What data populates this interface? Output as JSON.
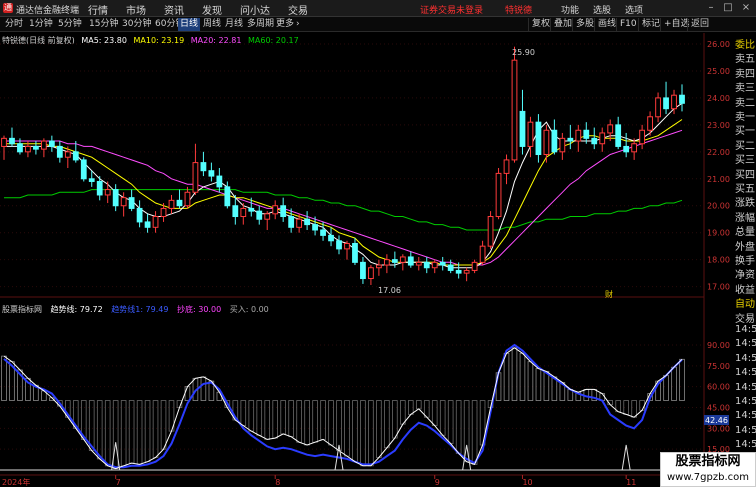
{
  "titlebar": {
    "app_title": "通达信金融终端",
    "menu": [
      "行情",
      "市场",
      "资讯",
      "发现",
      "问小达",
      "交易"
    ],
    "notice": "证券交易未登录",
    "stock_name": "特锐德",
    "right_menu": [
      "功能",
      "选股",
      "选项"
    ],
    "min_btn": "–",
    "max_btn": "□",
    "close_btn": "×"
  },
  "periodbar": {
    "tabs": [
      "分时",
      "1分钟",
      "5分钟",
      "15分钟",
      "30分钟",
      "60分钟",
      "日线",
      "周线",
      "月线",
      "多周期",
      "更多"
    ],
    "active_tab": "日线",
    "more_arrow": "›",
    "tools": [
      "复权",
      "叠加",
      "多股",
      "画线",
      "F10",
      "标记",
      "+自选",
      "返回"
    ]
  },
  "main_legend": {
    "title": "特锐德(日线 前复权)",
    "ma5": "MA5: 23.80",
    "ma10": "MA10: 23.19",
    "ma20": "MA20: 22.81",
    "ma60": "MA60: 20.17"
  },
  "indicator_legend": {
    "name": "股票指标网",
    "trend": "趋势线: 79.72",
    "trend2": "趋势线1: 79.49",
    "bottom": "抄底: 30.00",
    "buy": "买入: 0.00"
  },
  "price_axis": [
    "26.00",
    "25.00",
    "24.00",
    "23.00",
    "22.00",
    "21.00",
    "20.00",
    "19.00",
    "18.00",
    "17.00"
  ],
  "ind_axis": [
    "90.00",
    "75.00",
    "60.00",
    "45.00",
    "30.00",
    "15.00"
  ],
  "ind_marker": "42.46",
  "annotations": {
    "high": "25.90",
    "low": "17.06",
    "cai": "财"
  },
  "x_labels": [
    "2024年",
    "7",
    "8",
    "9",
    "10",
    "11"
  ],
  "side_panel": [
    {
      "text": "委比",
      "color": "yellow"
    },
    {
      "text": "卖五",
      "color": "normal"
    },
    {
      "text": "卖四",
      "color": "normal"
    },
    {
      "text": "卖三",
      "color": "normal"
    },
    {
      "text": "卖二",
      "color": "normal"
    },
    {
      "text": "卖一",
      "color": "normal"
    },
    {
      "text": "买一",
      "color": "normal"
    },
    {
      "text": "买二",
      "color": "normal"
    },
    {
      "text": "买三",
      "color": "normal"
    },
    {
      "text": "买四",
      "color": "normal"
    },
    {
      "text": "买五",
      "color": "normal"
    },
    {
      "text": "涨跌",
      "color": "normal"
    },
    {
      "text": "涨幅",
      "color": "normal"
    },
    {
      "text": "总量",
      "color": "normal"
    },
    {
      "text": "外盘",
      "color": "normal"
    },
    {
      "text": "换手",
      "color": "normal"
    },
    {
      "text": "净资",
      "color": "normal"
    },
    {
      "text": "收益",
      "color": "normal"
    },
    {
      "text": "自动",
      "color": "yellow"
    },
    {
      "text": "交易",
      "color": "normal"
    },
    {
      "text": "14:5",
      "color": "normal"
    },
    {
      "text": "14:5",
      "color": "normal"
    },
    {
      "text": "14:5",
      "color": "normal"
    },
    {
      "text": "14:5",
      "color": "normal"
    },
    {
      "text": "14:5",
      "color": "normal"
    },
    {
      "text": "14:5",
      "color": "normal"
    },
    {
      "text": "14:5",
      "color": "normal"
    },
    {
      "text": "14:5",
      "color": "normal"
    },
    {
      "text": "14:5",
      "color": "normal"
    }
  ],
  "watermark": {
    "line1": "股票指标网",
    "line2": "www.7gpzb.com"
  },
  "colors": {
    "up": "#ff3b3b",
    "down": "#54ffff",
    "ma5": "#ffffff",
    "ma10": "#ffff00",
    "ma20": "#ff4dff",
    "ma60": "#00cc00",
    "trend": "#ffffff",
    "trend1": "#2a3cff",
    "bottom": "#ff44ff"
  },
  "chart_data": {
    "type": "candlestick",
    "ylim": [
      16.8,
      26.4
    ],
    "candles": [
      [
        22.2,
        22.6,
        21.7,
        22.5
      ],
      [
        22.5,
        22.9,
        22.2,
        22.3
      ],
      [
        22.3,
        22.5,
        21.9,
        22.0
      ],
      [
        22.0,
        22.4,
        21.8,
        22.2
      ],
      [
        22.2,
        22.4,
        21.9,
        22.1
      ],
      [
        22.1,
        22.5,
        21.8,
        22.4
      ],
      [
        22.4,
        22.6,
        22.0,
        22.2
      ],
      [
        22.2,
        22.4,
        21.6,
        21.8
      ],
      [
        21.8,
        22.2,
        21.4,
        22.0
      ],
      [
        22.0,
        22.4,
        21.6,
        21.7
      ],
      [
        21.7,
        21.8,
        20.9,
        21.0
      ],
      [
        21.0,
        21.3,
        20.7,
        20.9
      ],
      [
        20.9,
        21.1,
        20.2,
        20.4
      ],
      [
        20.4,
        20.9,
        20.1,
        20.6
      ],
      [
        20.6,
        20.8,
        19.8,
        20.0
      ],
      [
        20.0,
        20.5,
        19.6,
        20.3
      ],
      [
        20.3,
        20.6,
        19.8,
        19.9
      ],
      [
        19.9,
        20.2,
        19.2,
        19.4
      ],
      [
        19.4,
        19.7,
        19.0,
        19.2
      ],
      [
        19.2,
        19.8,
        19.0,
        19.6
      ],
      [
        19.6,
        20.1,
        19.4,
        19.9
      ],
      [
        19.9,
        20.4,
        19.7,
        20.2
      ],
      [
        20.2,
        20.6,
        19.9,
        20.0
      ],
      [
        20.0,
        20.7,
        19.9,
        20.5
      ],
      [
        20.5,
        22.3,
        20.4,
        21.6
      ],
      [
        21.6,
        22.0,
        21.1,
        21.3
      ],
      [
        21.3,
        21.6,
        20.9,
        21.1
      ],
      [
        21.1,
        21.4,
        20.5,
        20.7
      ],
      [
        20.7,
        20.9,
        19.9,
        20.0
      ],
      [
        20.0,
        20.4,
        19.3,
        19.6
      ],
      [
        19.6,
        20.1,
        19.3,
        19.9
      ],
      [
        19.9,
        20.3,
        19.6,
        19.8
      ],
      [
        19.8,
        20.0,
        19.3,
        19.5
      ],
      [
        19.5,
        19.8,
        19.1,
        19.7
      ],
      [
        19.7,
        20.2,
        19.5,
        20.0
      ],
      [
        20.0,
        20.3,
        19.4,
        19.6
      ],
      [
        19.6,
        19.9,
        19.0,
        19.2
      ],
      [
        19.2,
        19.7,
        19.0,
        19.5
      ],
      [
        19.5,
        19.8,
        19.1,
        19.3
      ],
      [
        19.3,
        19.6,
        18.9,
        19.1
      ],
      [
        19.1,
        19.4,
        18.7,
        18.9
      ],
      [
        18.9,
        19.2,
        18.5,
        18.7
      ],
      [
        18.7,
        18.9,
        18.2,
        18.4
      ],
      [
        18.4,
        18.7,
        18.0,
        18.6
      ],
      [
        18.6,
        18.8,
        17.8,
        17.9
      ],
      [
        17.9,
        18.1,
        17.1,
        17.3
      ],
      [
        17.3,
        17.8,
        17.06,
        17.7
      ],
      [
        17.7,
        18.0,
        17.4,
        17.8
      ],
      [
        17.8,
        18.2,
        17.5,
        18.0
      ],
      [
        18.0,
        18.3,
        17.7,
        17.9
      ],
      [
        17.9,
        18.2,
        17.6,
        18.1
      ],
      [
        18.1,
        18.3,
        17.7,
        17.8
      ],
      [
        17.8,
        18.1,
        17.6,
        17.9
      ],
      [
        17.9,
        18.1,
        17.5,
        17.7
      ],
      [
        17.7,
        18.0,
        17.5,
        17.9
      ],
      [
        17.9,
        18.1,
        17.6,
        17.8
      ],
      [
        17.8,
        18.0,
        17.5,
        17.6
      ],
      [
        17.6,
        17.9,
        17.3,
        17.5
      ],
      [
        17.5,
        17.7,
        17.2,
        17.6
      ],
      [
        17.6,
        18.0,
        17.5,
        17.9
      ],
      [
        17.9,
        18.7,
        17.8,
        18.5
      ],
      [
        18.5,
        19.8,
        18.4,
        19.6
      ],
      [
        19.6,
        21.4,
        19.5,
        21.2
      ],
      [
        21.2,
        21.9,
        20.8,
        21.7
      ],
      [
        21.7,
        25.9,
        21.6,
        25.4
      ],
      [
        23.5,
        24.3,
        21.9,
        22.2
      ],
      [
        22.2,
        23.3,
        21.8,
        23.1
      ],
      [
        23.1,
        23.4,
        21.6,
        21.9
      ],
      [
        21.9,
        23.0,
        21.6,
        22.8
      ],
      [
        22.8,
        23.2,
        21.9,
        22.0
      ],
      [
        22.0,
        22.7,
        21.7,
        22.5
      ],
      [
        22.5,
        23.0,
        22.1,
        22.4
      ],
      [
        22.4,
        23.0,
        22.0,
        22.8
      ],
      [
        22.8,
        23.1,
        22.3,
        22.5
      ],
      [
        22.5,
        22.9,
        22.1,
        22.3
      ],
      [
        22.3,
        22.9,
        22.0,
        22.7
      ],
      [
        22.7,
        23.2,
        22.4,
        23.0
      ],
      [
        23.0,
        23.3,
        22.1,
        22.2
      ],
      [
        22.2,
        22.7,
        21.8,
        22.0
      ],
      [
        22.0,
        22.5,
        21.7,
        22.3
      ],
      [
        22.3,
        23.0,
        22.1,
        22.8
      ],
      [
        22.8,
        23.5,
        22.6,
        23.3
      ],
      [
        23.3,
        24.2,
        23.1,
        24.0
      ],
      [
        24.0,
        24.6,
        23.4,
        23.6
      ],
      [
        23.6,
        24.3,
        23.4,
        24.1
      ],
      [
        24.1,
        24.5,
        23.5,
        23.8
      ]
    ],
    "ma5": [
      22.2,
      22.2,
      22.2,
      22.2,
      22.2,
      22.2,
      22.2,
      22.1,
      22.0,
      21.9,
      21.6,
      21.3,
      21.0,
      20.8,
      20.5,
      20.3,
      20.2,
      19.9,
      19.7,
      19.6,
      19.6,
      19.7,
      19.8,
      20.1,
      20.5,
      20.7,
      20.8,
      20.9,
      20.7,
      20.3,
      20.0,
      19.9,
      19.7,
      19.7,
      19.8,
      19.7,
      19.6,
      19.5,
      19.4,
      19.3,
      19.2,
      18.9,
      18.7,
      18.6,
      18.4,
      18.2,
      17.9,
      17.8,
      17.8,
      17.8,
      17.9,
      17.9,
      17.9,
      17.9,
      17.8,
      17.8,
      17.7,
      17.7,
      17.7,
      17.7,
      17.9,
      18.3,
      19.0,
      19.8,
      20.9,
      21.6,
      22.2,
      22.8,
      23.1,
      22.6,
      22.4,
      22.4,
      22.4,
      22.4,
      22.4,
      22.5,
      22.6,
      22.6,
      22.5,
      22.4,
      22.5,
      22.7,
      23.0,
      23.3,
      23.6,
      23.8
    ],
    "ma10": [
      22.3,
      22.3,
      22.3,
      22.3,
      22.3,
      22.3,
      22.2,
      22.2,
      22.1,
      22.0,
      21.9,
      21.8,
      21.6,
      21.4,
      21.2,
      21.0,
      20.8,
      20.5,
      20.3,
      20.1,
      20.0,
      19.9,
      19.9,
      19.9,
      20.1,
      20.2,
      20.3,
      20.4,
      20.4,
      20.3,
      20.3,
      20.2,
      20.1,
      20.0,
      19.9,
      19.8,
      19.7,
      19.6,
      19.5,
      19.4,
      19.3,
      19.2,
      19.0,
      18.9,
      18.8,
      18.5,
      18.3,
      18.1,
      18.0,
      17.9,
      17.9,
      17.9,
      17.9,
      17.9,
      17.9,
      17.8,
      17.8,
      17.8,
      17.8,
      17.8,
      17.9,
      18.1,
      18.5,
      18.9,
      19.5,
      20.1,
      20.7,
      21.3,
      21.8,
      22.0,
      22.2,
      22.3,
      22.5,
      22.6,
      22.6,
      22.5,
      22.5,
      22.5,
      22.4,
      22.4,
      22.4,
      22.5,
      22.6,
      22.8,
      23.0,
      23.2
    ],
    "ma20": [
      22.4,
      22.4,
      22.4,
      22.4,
      22.4,
      22.4,
      22.4,
      22.4,
      22.3,
      22.3,
      22.2,
      22.2,
      22.1,
      22.0,
      21.9,
      21.8,
      21.7,
      21.6,
      21.5,
      21.3,
      21.2,
      21.0,
      20.9,
      20.8,
      20.8,
      20.7,
      20.6,
      20.5,
      20.4,
      20.3,
      20.2,
      20.1,
      20.0,
      19.9,
      19.9,
      19.9,
      19.8,
      19.7,
      19.6,
      19.5,
      19.4,
      19.3,
      19.2,
      19.1,
      19.0,
      18.9,
      18.8,
      18.7,
      18.6,
      18.5,
      18.4,
      18.3,
      18.2,
      18.1,
      18.0,
      17.9,
      17.9,
      17.8,
      17.8,
      17.8,
      17.8,
      17.9,
      18.1,
      18.4,
      18.7,
      19.0,
      19.3,
      19.6,
      19.9,
      20.2,
      20.5,
      20.8,
      21.0,
      21.3,
      21.5,
      21.7,
      21.9,
      22.0,
      22.1,
      22.2,
      22.3,
      22.4,
      22.5,
      22.6,
      22.7,
      22.8
    ],
    "ma60": [
      20.3,
      20.3,
      20.3,
      20.4,
      20.4,
      20.4,
      20.4,
      20.5,
      20.5,
      20.5,
      20.5,
      20.6,
      20.6,
      20.6,
      20.6,
      20.6,
      20.6,
      20.6,
      20.6,
      20.6,
      20.6,
      20.6,
      20.6,
      20.6,
      20.6,
      20.6,
      20.6,
      20.6,
      20.6,
      20.6,
      20.5,
      20.5,
      20.5,
      20.5,
      20.4,
      20.4,
      20.4,
      20.3,
      20.3,
      20.2,
      20.2,
      20.1,
      20.1,
      20.0,
      20.0,
      19.9,
      19.8,
      19.8,
      19.7,
      19.6,
      19.6,
      19.5,
      19.4,
      19.4,
      19.3,
      19.3,
      19.2,
      19.2,
      19.1,
      19.1,
      19.1,
      19.1,
      19.1,
      19.2,
      19.2,
      19.3,
      19.4,
      19.4,
      19.5,
      19.5,
      19.5,
      19.6,
      19.6,
      19.6,
      19.7,
      19.7,
      19.7,
      19.8,
      19.8,
      19.9,
      19.9,
      20.0,
      20.0,
      20.1,
      20.1,
      20.2
    ],
    "ind_ylim": [
      0,
      100
    ],
    "trend": [
      82,
      78,
      72,
      66,
      61,
      57,
      52,
      46,
      38,
      30,
      22,
      14,
      8,
      3,
      1,
      3,
      5,
      4,
      6,
      9,
      15,
      28,
      45,
      60,
      66,
      67,
      64,
      56,
      45,
      36,
      32,
      28,
      25,
      22,
      23,
      26,
      24,
      20,
      18,
      20,
      22,
      18,
      14,
      10,
      6,
      3,
      3,
      9,
      16,
      23,
      33,
      40,
      44,
      38,
      32,
      25,
      19,
      12,
      6,
      4,
      18,
      45,
      70,
      84,
      88,
      84,
      78,
      73,
      71,
      67,
      63,
      58,
      56,
      58,
      58,
      55,
      47,
      42,
      40,
      38,
      43,
      55,
      64,
      68,
      74,
      79.7
    ],
    "trend1": [
      80,
      75,
      69,
      63,
      60,
      58,
      55,
      48,
      40,
      32,
      24,
      17,
      10,
      4,
      2,
      2,
      3,
      3,
      4,
      6,
      10,
      19,
      33,
      48,
      57,
      62,
      63,
      58,
      48,
      38,
      30,
      25,
      21,
      17,
      15,
      16,
      15,
      13,
      11,
      10,
      11,
      10,
      9,
      8,
      6,
      4,
      4,
      6,
      10,
      14,
      22,
      29,
      34,
      32,
      28,
      23,
      18,
      12,
      8,
      5,
      14,
      42,
      70,
      86,
      90,
      86,
      80,
      74,
      70,
      66,
      62,
      58,
      55,
      53,
      52,
      50,
      40,
      36,
      32,
      30,
      36,
      52,
      62,
      68,
      74,
      79.5
    ],
    "bottom": [
      30,
      30,
      30,
      30,
      30,
      30,
      30,
      30,
      30,
      30,
      30,
      30,
      30,
      30,
      30,
      30,
      30,
      30,
      30,
      30,
      30,
      30,
      30,
      30,
      30,
      30,
      30,
      30,
      30,
      30,
      30,
      30,
      30,
      30,
      30,
      30,
      30,
      30,
      30,
      30,
      30,
      30,
      30,
      30,
      30,
      30,
      30,
      30,
      30,
      30,
      30,
      30,
      30,
      30,
      30,
      30,
      30,
      30,
      30,
      30,
      30,
      30,
      30,
      30,
      30,
      30,
      30,
      30,
      30,
      30,
      30,
      30,
      30,
      30,
      30,
      30,
      30,
      30,
      30,
      30,
      30,
      30,
      30,
      30,
      30,
      30
    ],
    "buy_spikes": [
      {
        "i": 14,
        "v": 20
      },
      {
        "i": 42,
        "v": 18
      },
      {
        "i": 58,
        "v": 18
      },
      {
        "i": 78,
        "v": 18
      }
    ]
  }
}
